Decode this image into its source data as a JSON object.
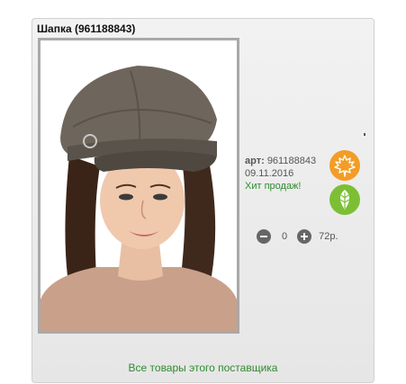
{
  "product": {
    "title": "Шапка (961188843)",
    "art_label": "арт:",
    "art_number": "961188843",
    "date": "09.11.2016",
    "hit_label": "Хит продаж!"
  },
  "badges": [
    {
      "icon": "maple-leaf-icon",
      "color": "#f39c26"
    },
    {
      "icon": "leaf-icon",
      "color": "#7cbf35"
    }
  ],
  "cart": {
    "quantity": "0",
    "price": "72р."
  },
  "footer": {
    "supplier_link": "Все товары этого поставщика"
  }
}
